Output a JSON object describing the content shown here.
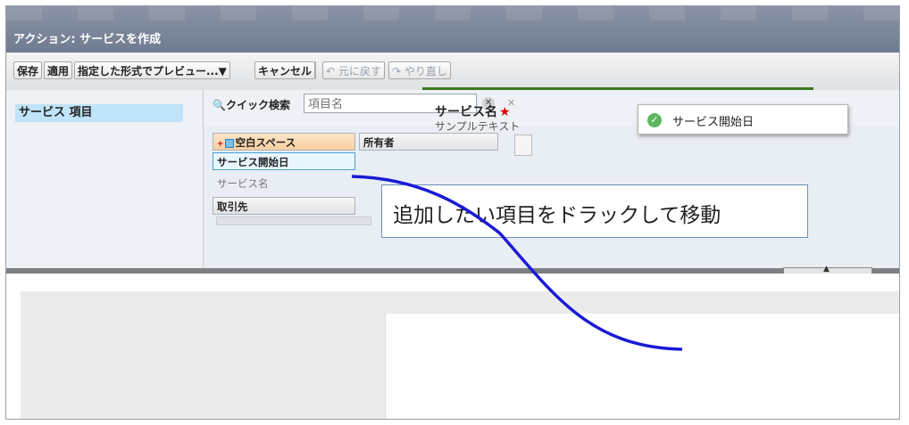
{
  "window": {
    "title": "アクション: サービスを作成"
  },
  "toolbar": {
    "save": "保存",
    "apply": "適用",
    "preview": "指定した形式でプレビュー...▼",
    "cancel": "キャンセル",
    "undo": "元に戻す",
    "redo": "やり直し"
  },
  "palette": {
    "category": "サービス 項目",
    "search": {
      "label": "クイック検索",
      "placeholder": "項目名"
    },
    "fields": [
      {
        "label": "空白スペース",
        "plus": "+"
      },
      {
        "label": "所有者"
      },
      {
        "label": "サービス開始日"
      },
      {
        "label": "サービス名"
      },
      {
        "label": "取引先"
      }
    ]
  },
  "callout": {
    "text": "追加したい項目をドラックして移動"
  },
  "layout": {
    "field_label": "サービス名",
    "required_mark": "★",
    "field_sample": "サンプルテキスト",
    "dragged_chip": "サービス開始日"
  }
}
